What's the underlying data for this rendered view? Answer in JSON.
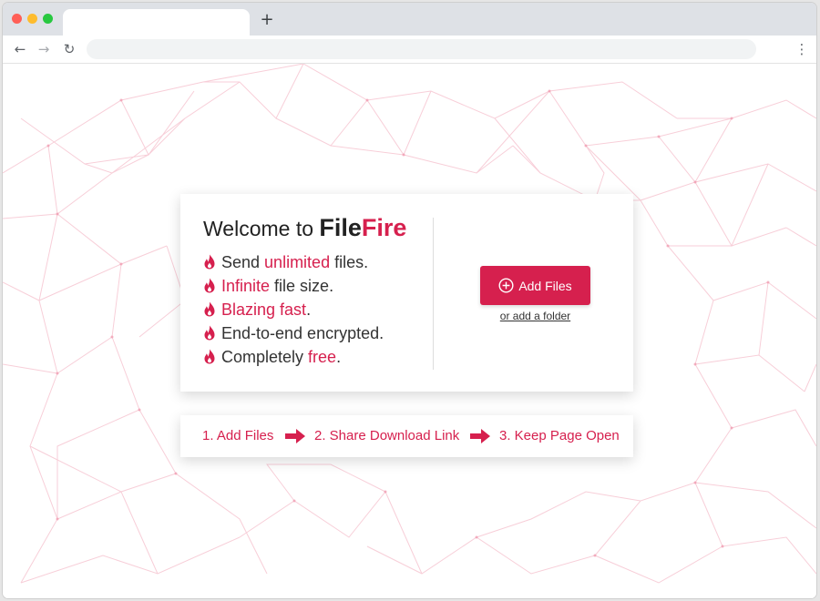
{
  "browser": {
    "new_tab_glyph": "+",
    "nav": {
      "back": "←",
      "forward": "→",
      "reload": "↻",
      "menu": "⋮"
    }
  },
  "welcome": {
    "title_prefix": "Welcome to",
    "brand_a": "File",
    "brand_b": "Fire"
  },
  "features": [
    {
      "before": "Send ",
      "highlight": "unlimited",
      "after": " files."
    },
    {
      "before": "",
      "highlight": "Infinite",
      "after": " file size."
    },
    {
      "before": "",
      "highlight": "Blazing fast",
      "after": "."
    },
    {
      "before": "End-to-end encrypted.",
      "highlight": "",
      "after": ""
    },
    {
      "before": "Completely ",
      "highlight": "free",
      "after": "."
    }
  ],
  "actions": {
    "add_files_label": "Add Files",
    "add_folder_label": "or add a folder"
  },
  "steps": [
    "1. Add Files",
    "2. Share Download Link",
    "3. Keep Page Open"
  ],
  "colors": {
    "accent": "#d6204e",
    "text": "#333333",
    "background": "#ffffff"
  },
  "icons": {
    "feature": "fire-icon",
    "button": "plus-circle-icon",
    "step_separator": "arrow-right-icon"
  }
}
